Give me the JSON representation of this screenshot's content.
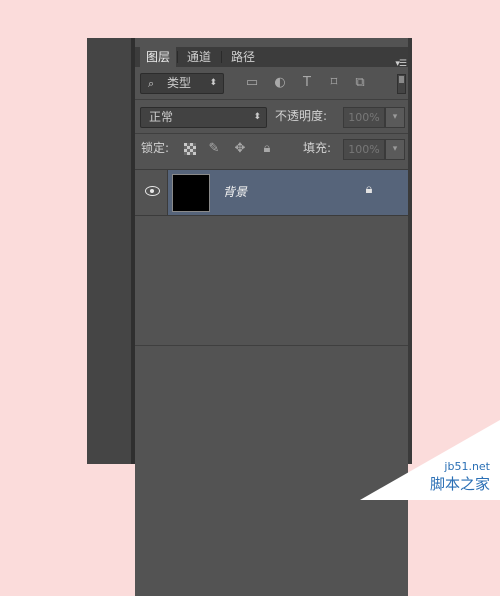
{
  "tabs": [
    {
      "label": "图层",
      "active": true
    },
    {
      "label": "通道",
      "active": false
    },
    {
      "label": "路径",
      "active": false
    }
  ],
  "panel_menu_icon": "panel-menu-icon",
  "filter": {
    "label": "类型",
    "search_icon": "⌕",
    "icons": [
      "image-filter-icon",
      "adjustment-filter-icon",
      "type-filter-icon",
      "shape-filter-icon",
      "smartobject-filter-icon"
    ]
  },
  "blend": {
    "mode": "正常",
    "opacity_label": "不透明度:",
    "opacity_value": "100%"
  },
  "lock": {
    "label": "锁定:",
    "icons": [
      "lock-transparent-pixels-icon",
      "lock-image-pixels-icon",
      "lock-position-icon",
      "lock-all-icon"
    ],
    "fill_label": "填充:",
    "fill_value": "100%"
  },
  "layers": [
    {
      "name": "背景",
      "visible": true,
      "locked": true,
      "selected": true
    }
  ],
  "colors": {
    "page_background": "#fbdcdb",
    "panel": "#535353",
    "selected_row": "#56647a",
    "watermark": "#2a6fb5"
  },
  "watermark": {
    "line1": "jb51.net",
    "line2": "脚本之家"
  }
}
